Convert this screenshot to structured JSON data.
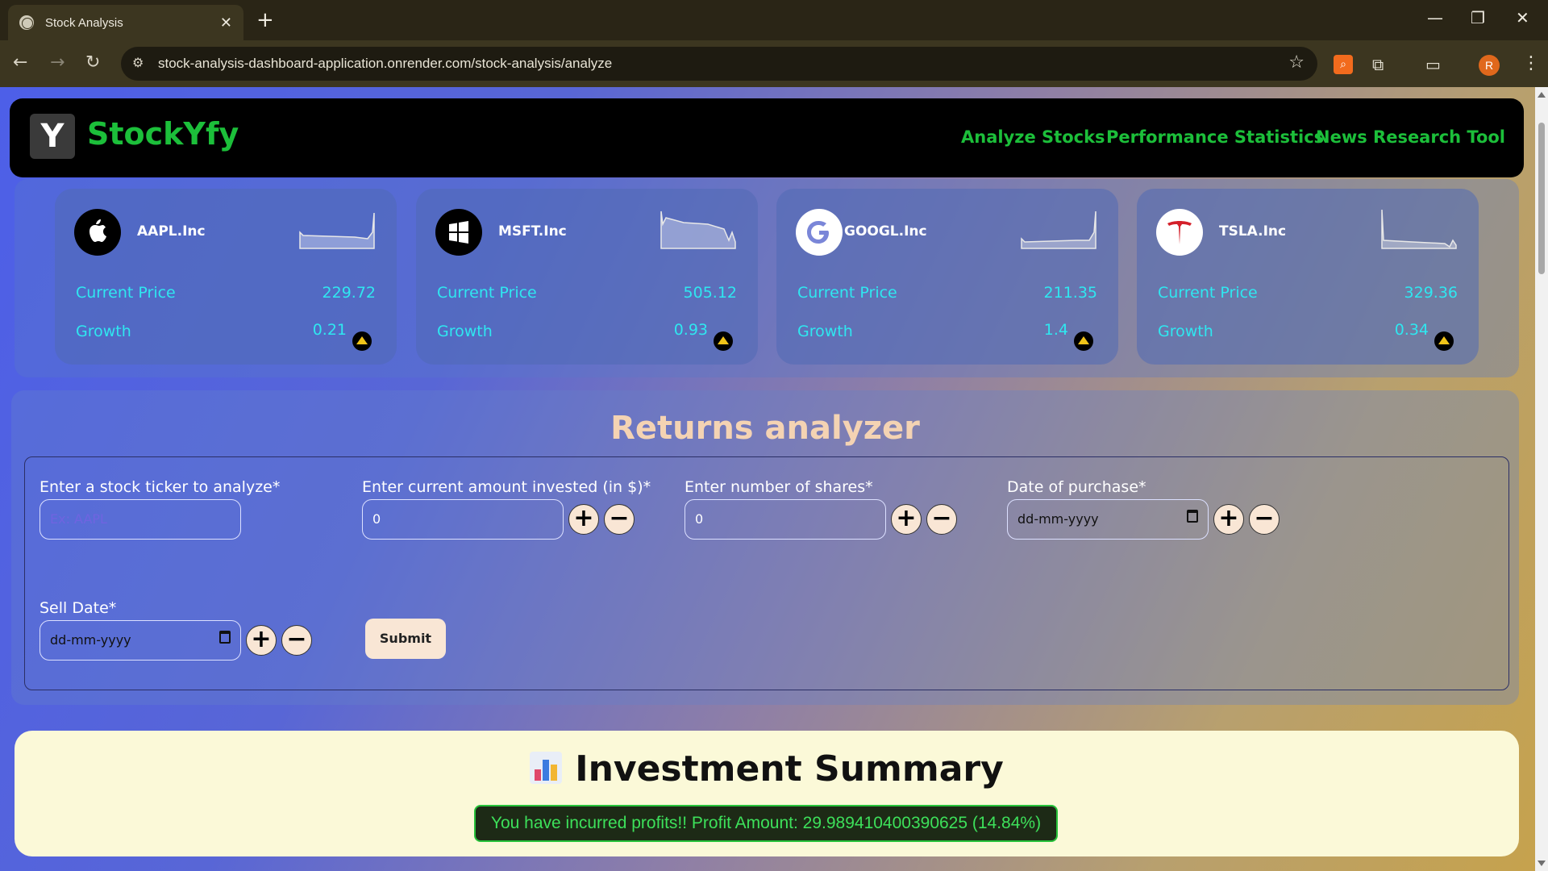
{
  "browser": {
    "tab_title": "Stock Analysis",
    "url": "stock-analysis-dashboard-application.onrender.com/stock-analysis/analyze",
    "profile_initial": "R"
  },
  "navbar": {
    "logo_letter": "Y",
    "brand": "StockYfy",
    "links": [
      "Analyze Stocks",
      "Performance Statistics",
      "News Research Tool"
    ]
  },
  "stocks": [
    {
      "ticker": "AAPL.Inc",
      "logo": "apple-icon",
      "price_label": "Current Price",
      "price": "229.72",
      "growth_label": "Growth",
      "growth": "0.21",
      "trend": "up"
    },
    {
      "ticker": "MSFT.Inc",
      "logo": "windows-icon",
      "price_label": "Current Price",
      "price": "505.12",
      "growth_label": "Growth",
      "growth": "0.93",
      "trend": "up"
    },
    {
      "ticker": "GOOGL.Inc",
      "logo": "google-icon",
      "price_label": "Current Price",
      "price": "211.35",
      "growth_label": "Growth",
      "growth": "1.4",
      "trend": "up"
    },
    {
      "ticker": "TSLA.Inc",
      "logo": "tesla-icon",
      "price_label": "Current Price",
      "price": "329.36",
      "growth_label": "Growth",
      "growth": "0.34",
      "trend": "up"
    }
  ],
  "analyzer": {
    "title": "Returns analyzer",
    "ticker_label": "Enter a stock ticker to analyze*",
    "ticker_placeholder": "Ex: AAPL",
    "amount_label": "Enter current amount invested (in $)*",
    "amount_value": "0",
    "shares_label": "Enter number of shares*",
    "shares_value": "0",
    "purchase_label": "Date of purchase*",
    "date_placeholder": "dd-mm-yyyy",
    "sell_label": "Sell Date*",
    "submit": "Submit",
    "plus": "+",
    "minus": "−"
  },
  "summary": {
    "title": "Investment Summary",
    "message": "You have incurred profits!! Profit Amount: 29.989410400390625 (14.84%)"
  },
  "colors": {
    "brand_green": "#1cbf3a",
    "card_text": "#2fe7f0",
    "title_peach": "#f4d3b3",
    "profit_green": "#3de05a"
  }
}
